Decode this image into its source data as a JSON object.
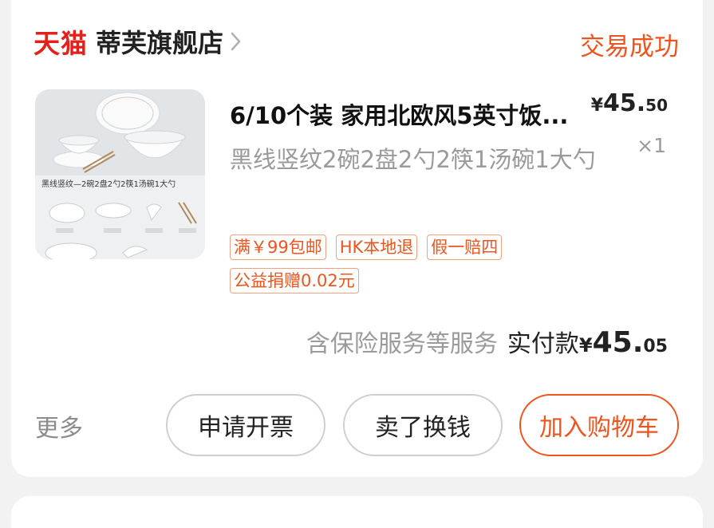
{
  "shop": {
    "platform_logo": "天猫",
    "name": "蒂芙旗舰店",
    "order_status": "交易成功"
  },
  "product": {
    "title": "6/10个装 家用北欧风5英寸饭...",
    "sku": "黑线竖纹2碗2盘2勺2筷1汤碗1大勺",
    "price": {
      "currency": "¥",
      "integer": "45.",
      "decimal": "50"
    },
    "quantity": "×1",
    "thumbnail": {
      "caption": "黑线竖纹—2碗2盘2勺2筷1汤碗1大勺"
    },
    "tags": [
      "满￥99包邮",
      "HK本地退",
      "假一赔四",
      "公益捐赠0.02元"
    ]
  },
  "summary": {
    "insurance_note": "含保险服务等服务",
    "paid_label": "实付款",
    "paid_currency": "¥",
    "paid_integer": "45.",
    "paid_decimal": "05"
  },
  "actions": {
    "more_label": "更多",
    "invoice_label": "申请开票",
    "resell_label": "卖了换钱",
    "add_cart_label": "加入购物车"
  },
  "colors": {
    "accent": "#f0541e",
    "tmall_red": "#e4201a",
    "muted": "#9a9a9a",
    "background": "#f2f2f2"
  }
}
